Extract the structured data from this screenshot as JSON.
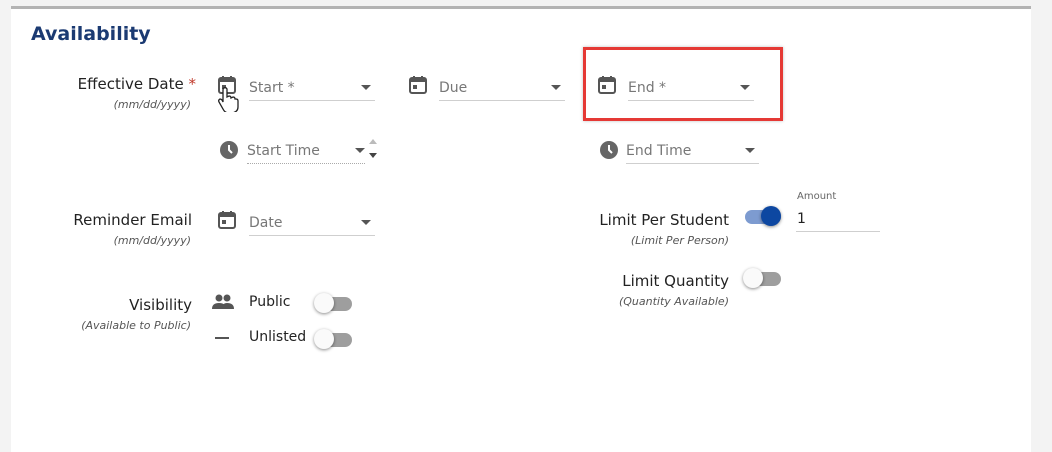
{
  "section": {
    "title": "Availability"
  },
  "effective_date": {
    "label": "Effective Date",
    "required_mark": "*",
    "format_hint": "(mm/dd/yyyy)",
    "start_placeholder": "Start *",
    "due_placeholder": "Due",
    "end_placeholder": "End *",
    "start_time_placeholder": "Start Time",
    "end_time_placeholder": "End Time"
  },
  "reminder_email": {
    "label": "Reminder Email",
    "format_hint": "(mm/dd/yyyy)",
    "date_placeholder": "Date"
  },
  "visibility": {
    "label": "Visibility",
    "hint": "(Available to Public)",
    "options": [
      {
        "label": "Public",
        "icon": "people-icon",
        "enabled": false
      },
      {
        "label": "Unlisted",
        "icon": "dash-icon",
        "enabled": false
      }
    ]
  },
  "limit_per_student": {
    "label": "Limit Per Student",
    "hint": "(Limit Per Person)",
    "enabled": true,
    "amount_label": "Amount",
    "amount_value": "1"
  },
  "limit_quantity": {
    "label": "Limit Quantity",
    "hint": "(Quantity Available)",
    "enabled": false
  },
  "colors": {
    "title": "#1b3a72",
    "required": "#c0392b",
    "toggle_on": "#0d47a1",
    "highlight": "#e53935"
  }
}
